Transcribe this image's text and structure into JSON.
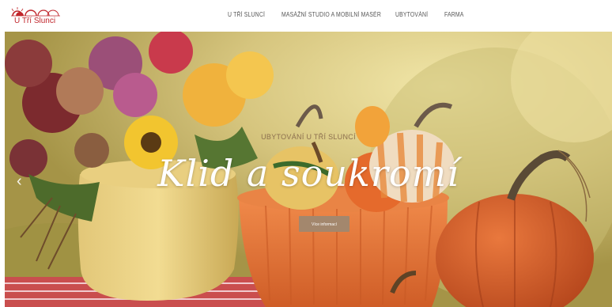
{
  "logo": {
    "text": "U Tří Slunci",
    "icon": "three-suns-logo"
  },
  "nav": {
    "items": [
      {
        "label": "U TŘÍ SLUNCÍ"
      },
      {
        "label": "MASÁŽNÍ STUDIO A MOBILNÍ MASÉR"
      },
      {
        "label": "UBYTOVÁNÍ"
      },
      {
        "label": "FARMA"
      }
    ]
  },
  "hero": {
    "subtitle": "UBYTOVÁNÍ U TŘÍ SLUNCÍ",
    "title": "Klid a soukromí",
    "button_label": "Více informací",
    "prev_icon": "chevron-left-icon"
  }
}
